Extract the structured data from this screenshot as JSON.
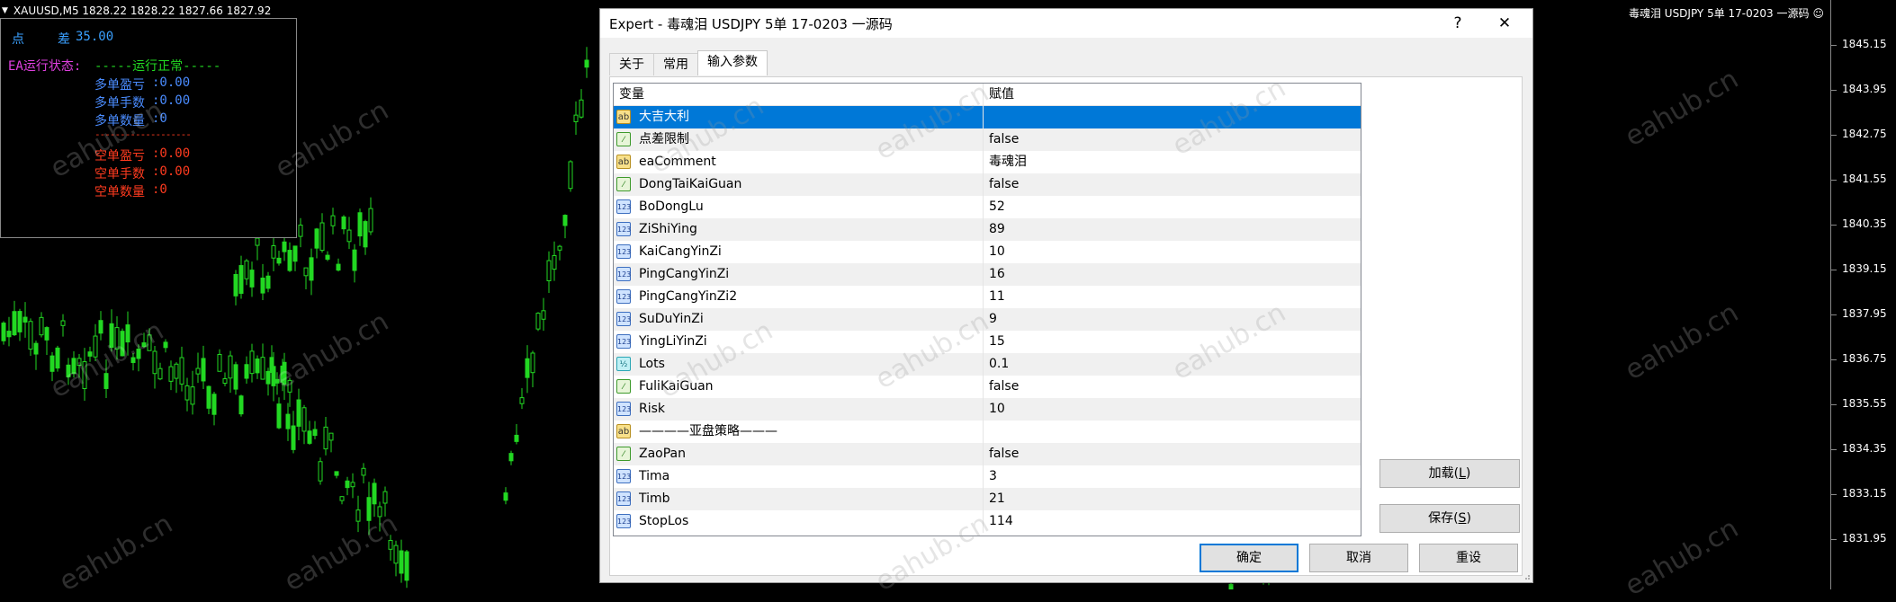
{
  "chart": {
    "symbol_header": "XAUUSD,M5  1828.22 1828.22 1827.66 1827.92",
    "ea_label": "毒魂泪 USDJPY 5单 17-0203 一源码",
    "price_labels": [
      "1845.15",
      "1843.95",
      "1842.75",
      "1841.55",
      "1840.35",
      "1839.15",
      "1837.95",
      "1836.75",
      "1835.55",
      "1834.35",
      "1833.15",
      "1831.95"
    ],
    "colors": {
      "bull": "#22d822",
      "bear": "#22d822",
      "background": "#000000"
    }
  },
  "ea_panel": {
    "line1_a": "点",
    "line1_b": "差",
    "spread": "35.00",
    "status_label": "EA运行状态:",
    "status_value": "-----运行正常-----",
    "buy_profit_label": "多单盈亏",
    "buy_profit": ":0.00",
    "buy_lots_label": "多单手数",
    "buy_lots": ":0.00",
    "buy_count_label": "多单数量",
    "buy_count": ":0",
    "separator": "-------------------",
    "sell_profit_label": "空单盈亏",
    "sell_profit": ":0.00",
    "sell_lots_label": "空单手数",
    "sell_lots": ":0.00",
    "sell_count_label": "空单数量",
    "sell_count": ":0"
  },
  "watermark": "eahub.cn",
  "dialog": {
    "title": "Expert - 毒魂泪 USDJPY 5单 17-0203 一源码",
    "help_glyph": "?",
    "close_glyph": "✕",
    "tabs": [
      {
        "label": "关于"
      },
      {
        "label": "常用"
      },
      {
        "label": "输入参数"
      }
    ],
    "table": {
      "col_var": "变量",
      "col_val": "赋值",
      "rows": [
        {
          "type": "ab",
          "name": "大吉大利",
          "value": ""
        },
        {
          "type": "bool",
          "name": "点差限制",
          "value": "false"
        },
        {
          "type": "ab",
          "name": "eaComment",
          "value": "毒魂泪"
        },
        {
          "type": "bool",
          "name": "DongTaiKaiGuan",
          "value": "false"
        },
        {
          "type": "int",
          "name": "BoDongLu",
          "value": "52"
        },
        {
          "type": "int",
          "name": "ZiShiYing",
          "value": "89"
        },
        {
          "type": "int",
          "name": "KaiCangYinZi",
          "value": "10"
        },
        {
          "type": "int",
          "name": "PingCangYinZi",
          "value": "16"
        },
        {
          "type": "int",
          "name": "PingCangYinZi2",
          "value": "11"
        },
        {
          "type": "int",
          "name": "SuDuYinZi",
          "value": "9"
        },
        {
          "type": "int",
          "name": "YingLiYinZi",
          "value": "15"
        },
        {
          "type": "dbl",
          "name": "Lots",
          "value": "0.1"
        },
        {
          "type": "bool",
          "name": "FuliKaiGuan",
          "value": "false"
        },
        {
          "type": "int",
          "name": "Risk",
          "value": "10"
        },
        {
          "type": "ab",
          "name": "————亚盘策略———",
          "value": ""
        },
        {
          "type": "bool",
          "name": "ZaoPan",
          "value": "false"
        },
        {
          "type": "int",
          "name": "Tima",
          "value": "3"
        },
        {
          "type": "int",
          "name": "Timb",
          "value": "21"
        },
        {
          "type": "int",
          "name": "StopLos",
          "value": "114"
        }
      ]
    },
    "icons": {
      "ab": "ab",
      "bool": "⁄",
      "int": "123",
      "dbl": "½"
    },
    "buttons": {
      "load": "加载(",
      "load_key": "L",
      "load_end": ")",
      "save": "保存(",
      "save_key": "S",
      "save_end": ")",
      "ok": "确定",
      "cancel": "取消",
      "reset": "重设"
    }
  }
}
